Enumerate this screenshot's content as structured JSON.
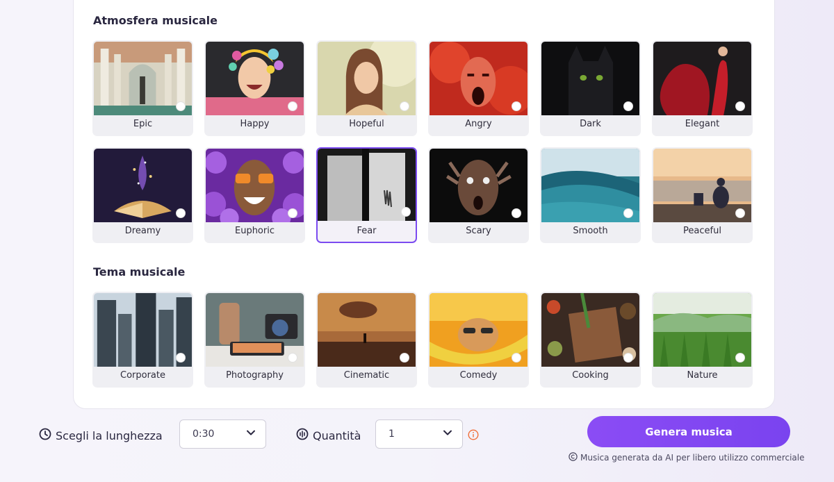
{
  "mood_section": {
    "title": "Atmosfera musicale",
    "items": [
      {
        "label": "Epic",
        "selected": false
      },
      {
        "label": "Happy",
        "selected": false
      },
      {
        "label": "Hopeful",
        "selected": false
      },
      {
        "label": "Angry",
        "selected": false
      },
      {
        "label": "Dark",
        "selected": false
      },
      {
        "label": "Elegant",
        "selected": false
      },
      {
        "label": "Dreamy",
        "selected": false
      },
      {
        "label": "Euphoric",
        "selected": false
      },
      {
        "label": "Fear",
        "selected": true
      },
      {
        "label": "Scary",
        "selected": false
      },
      {
        "label": "Smooth",
        "selected": false
      },
      {
        "label": "Peaceful",
        "selected": false
      }
    ]
  },
  "theme_section": {
    "title": "Tema musicale",
    "items": [
      {
        "label": "Corporate",
        "selected": false
      },
      {
        "label": "Photography",
        "selected": false
      },
      {
        "label": "Cinematic",
        "selected": false
      },
      {
        "label": "Comedy",
        "selected": false
      },
      {
        "label": "Cooking",
        "selected": false
      },
      {
        "label": "Nature",
        "selected": false
      }
    ]
  },
  "controls": {
    "length_label": "Scegli la lunghezza",
    "length_value": "0:30",
    "quantity_label": "Quantità",
    "quantity_value": "1",
    "generate_label": "Genera musica",
    "footnote": "Musica generata da AI per libero utilizzo commerciale"
  },
  "colors": {
    "accent": "#7b4bf0",
    "info": "#f0703a"
  }
}
